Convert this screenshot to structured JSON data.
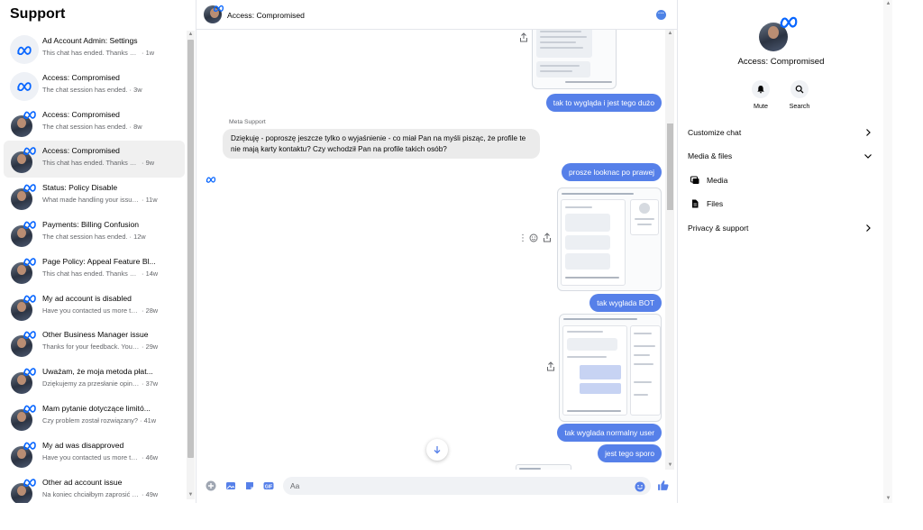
{
  "sidebar": {
    "title": "Support",
    "conversations": [
      {
        "name": "Ad Account Admin: Settings",
        "preview": "This chat has ended. Thanks agai...",
        "time": "1w",
        "avatar": "meta"
      },
      {
        "name": "Access: Compromised",
        "preview": "The chat session has ended.",
        "time": "3w",
        "avatar": "meta"
      },
      {
        "name": "Access: Compromised",
        "preview": "The chat session has ended.",
        "time": "8w",
        "avatar": "photo"
      },
      {
        "name": "Access: Compromised",
        "preview": "This chat has ended. Thanks agai...",
        "time": "9w",
        "avatar": "photo",
        "active": true
      },
      {
        "name": "Status: Policy Disable",
        "preview": "What made handling your issue ...",
        "time": "11w",
        "avatar": "photo"
      },
      {
        "name": "Payments: Billing Confusion",
        "preview": "The chat session has ended.",
        "time": "12w",
        "avatar": "photo"
      },
      {
        "name": "Page Policy: Appeal Feature Bl...",
        "preview": "This chat has ended. Thanks aga...",
        "time": "14w",
        "avatar": "photo"
      },
      {
        "name": "My ad account is disabled",
        "preview": "Have you contacted us more tha...",
        "time": "28w",
        "avatar": "photo"
      },
      {
        "name": "Other Business Manager issue",
        "preview": "Thanks for your feedback. Your r...",
        "time": "29w",
        "avatar": "photo"
      },
      {
        "name": "Uważam, że moja metoda płat...",
        "preview": "Dziękujemy za przesłanie opinii. ...",
        "time": "37w",
        "avatar": "photo"
      },
      {
        "name": "Mam pytanie dotyczące limitó...",
        "preview": "Czy problem został rozwiązany?",
        "time": "41w",
        "avatar": "photo"
      },
      {
        "name": "My ad was disapproved",
        "preview": "Have you contacted us more tha...",
        "time": "46w",
        "avatar": "photo"
      },
      {
        "name": "Other ad account issue",
        "preview": "Na koniec chciałbym zaprosić do...",
        "time": "49w",
        "avatar": "photo"
      }
    ]
  },
  "chat": {
    "title": "Access: Compromised",
    "sender_label": "Meta Support",
    "incoming_message": "Dziękuję - poproszę jeszcze tylko o wyjaśnienie - co miał Pan na myśli pisząc, że profile te nie mają karty kontaktu? Czy wchodził Pan na profile takich osób?",
    "outgoing": [
      {
        "id": "m1",
        "text": "tak to wygląda i jest tego dużo"
      },
      {
        "id": "m2",
        "text": "prosze looknac po prawej"
      },
      {
        "id": "m3",
        "text": "tak wyglada BOT"
      },
      {
        "id": "m4",
        "text": "tak wyglada normalny user"
      },
      {
        "id": "m5",
        "text": "jest tego sporo"
      }
    ],
    "composer_placeholder": "Aa"
  },
  "info_panel": {
    "name": "Access: Compromised",
    "actions": [
      {
        "label": "Mute",
        "icon": "bell-icon"
      },
      {
        "label": "Search",
        "icon": "search-icon"
      }
    ],
    "sections": {
      "customize": "Customize chat",
      "media_files": "Media & files",
      "media": "Media",
      "files": "Files",
      "privacy": "Privacy & support"
    }
  },
  "colors": {
    "accent": "#5680e9",
    "meta_blue": "#0866ff",
    "incoming_bubble": "#ebebeb"
  }
}
